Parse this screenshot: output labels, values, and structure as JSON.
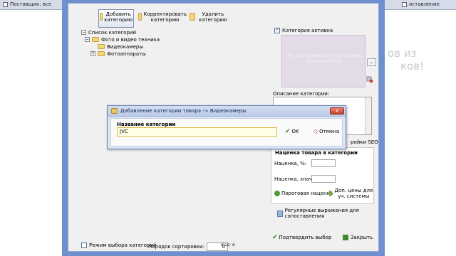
{
  "background": {
    "top_left_label": "Поставщик: все",
    "top_right_label": "оставление",
    "ghost_line1": "ов из",
    "ghost_line2": "ков!"
  },
  "toolbar": {
    "add_label": "Добавить категорию",
    "edit_label": "Корректировать категорию",
    "delete_label": "Удалить категорию"
  },
  "tree": {
    "root": "Список категорий",
    "items": [
      {
        "label": "Фото и видео техника"
      },
      {
        "label": "Видеокамеры"
      },
      {
        "label": "Фотоаппараты"
      }
    ]
  },
  "category_active_label": "Категория активна",
  "picture_placeholder": "Нет картинки для категории: Видеокамеры",
  "picture_button": "...",
  "description_label": "Описание категории:",
  "seo_label": "ройки SEO",
  "markup": {
    "title": "Наценка товара в категории",
    "percent_label": "Наценка, %:",
    "value_label": "Наценка, знач.:",
    "threshold_button": "Пороговая наценка",
    "extra_prices_button": "Доп. цены для уч. системы"
  },
  "regex_button": "Регулярные выражения для сопоставления",
  "footer": {
    "mode_label": "Режим выбора категорий",
    "sort_label": "Порядок сортировки:",
    "sort_value": "0",
    "code_label": "Код: 6",
    "confirm_button": "Подтвердить выбор",
    "close_button": "Закрыть"
  },
  "dialog": {
    "title": "Добавление категории товара -> Видеокамеры",
    "close_glyph": "x",
    "name_label": "Название категории",
    "name_value": "JVC",
    "ok_label": "OK",
    "cancel_label": "Отмена"
  },
  "colors": {
    "window_frame": "#6f8fcf",
    "dialog_input_bg": "#ffffe6",
    "picture_bg": "#e3dbe8"
  }
}
